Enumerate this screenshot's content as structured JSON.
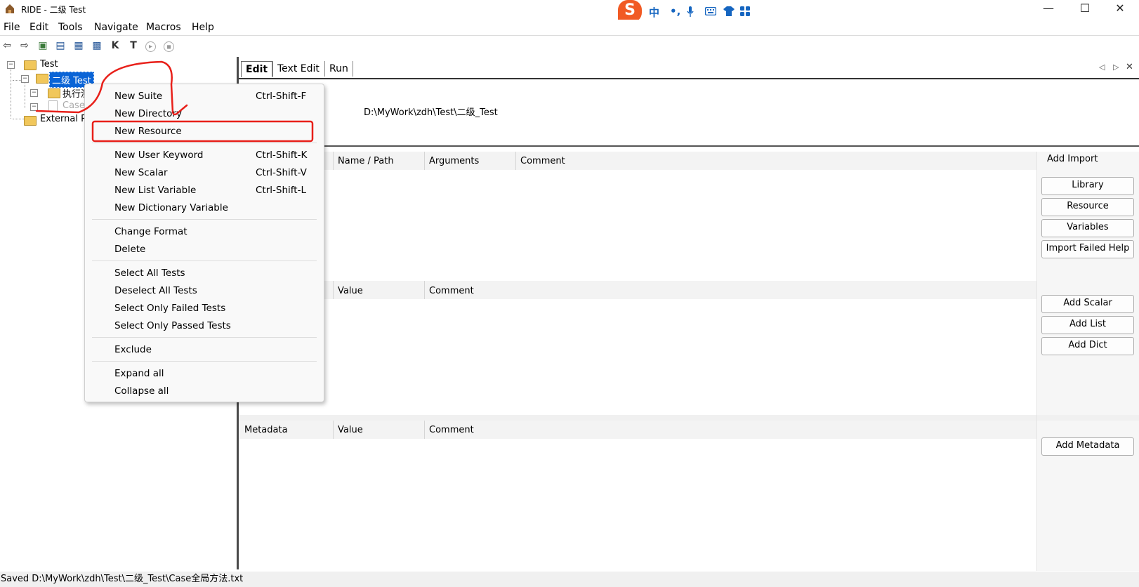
{
  "window": {
    "title": "RIDE - 二级 Test",
    "controls": [
      "—",
      "☐",
      "✕"
    ]
  },
  "ime": {
    "logo": "S",
    "items": [
      "中",
      "•,",
      "🎙",
      "⌨",
      "👕",
      "⊞"
    ]
  },
  "menubar": {
    "items": [
      "File",
      "Edit",
      "Tools",
      "Navigate",
      "Macros",
      "Help"
    ]
  },
  "toolbar": {
    "icons": [
      "back-arrow-icon",
      "forward-arrow-icon",
      "open-test-icon",
      "open-directory-icon",
      "save-icon",
      "save-all-icon",
      "search-keyword-icon",
      "search-test-icon",
      "run-icon",
      "stop-icon"
    ],
    "glyphs": [
      "⇦",
      "⇨",
      "▣",
      "▤",
      "▦",
      "▩",
      "K",
      "T",
      "▸",
      "◼"
    ]
  },
  "tree": {
    "items": [
      {
        "label": "Test",
        "level": 0
      },
      {
        "label": "二级 Test",
        "level": 1,
        "selected": true
      },
      {
        "label": "执行测",
        "level": 2
      },
      {
        "label": "Case",
        "level": 2
      },
      {
        "label": "External Res",
        "level": 0
      }
    ]
  },
  "tabs": [
    {
      "label": "Edit",
      "active": true
    },
    {
      "label": "Text Edit",
      "active": false
    },
    {
      "label": "Run",
      "active": false
    }
  ],
  "tab_nav": {
    "left": "◁",
    "right": "▷",
    "close": "✕"
  },
  "editor": {
    "source_path": "D:\\MyWork\\zdh\\Test\\二级_Test",
    "imports": {
      "columns": [
        "Name / Path",
        "Arguments",
        "Comment"
      ],
      "add_label": "Add Import",
      "buttons": [
        "Library",
        "Resource",
        "Variables",
        "Import Failed Help"
      ]
    },
    "variables": {
      "columns": [
        "Value",
        "Comment"
      ],
      "buttons": [
        "Add Scalar",
        "Add List",
        "Add Dict"
      ]
    },
    "metadata": {
      "columns": [
        "Metadata",
        "Value",
        "Comment"
      ],
      "buttons": [
        "Add Metadata"
      ]
    }
  },
  "context_menu": {
    "items": [
      {
        "label": "New Suite",
        "shortcut": "Ctrl-Shift-F"
      },
      {
        "label": "New Directory",
        "shortcut": ""
      },
      {
        "label": "New Resource",
        "shortcut": "",
        "highlighted": true
      },
      {
        "separator": true
      },
      {
        "label": "New User Keyword",
        "shortcut": "Ctrl-Shift-K"
      },
      {
        "label": "New Scalar",
        "shortcut": "Ctrl-Shift-V"
      },
      {
        "label": "New List Variable",
        "shortcut": "Ctrl-Shift-L"
      },
      {
        "label": "New Dictionary Variable",
        "shortcut": ""
      },
      {
        "separator": true
      },
      {
        "label": "Change Format",
        "shortcut": ""
      },
      {
        "label": "Delete",
        "shortcut": ""
      },
      {
        "separator": true
      },
      {
        "label": "Select All Tests",
        "shortcut": ""
      },
      {
        "label": "Deselect All Tests",
        "shortcut": ""
      },
      {
        "label": "Select Only Failed Tests",
        "shortcut": ""
      },
      {
        "label": "Select Only Passed Tests",
        "shortcut": ""
      },
      {
        "separator": true
      },
      {
        "label": "Exclude",
        "shortcut": ""
      },
      {
        "separator": true
      },
      {
        "label": "Expand all",
        "shortcut": ""
      },
      {
        "label": "Collapse all",
        "shortcut": ""
      }
    ]
  },
  "statusbar": {
    "text": "Saved D:\\MyWork\\zdh\\Test\\二级_Test\\Case全局方法.txt"
  },
  "colors": {
    "selection": "#0a64d6",
    "annotation_red": "#e8201a",
    "ime_orange": "#f15a24",
    "ime_blue": "#1565c0"
  }
}
